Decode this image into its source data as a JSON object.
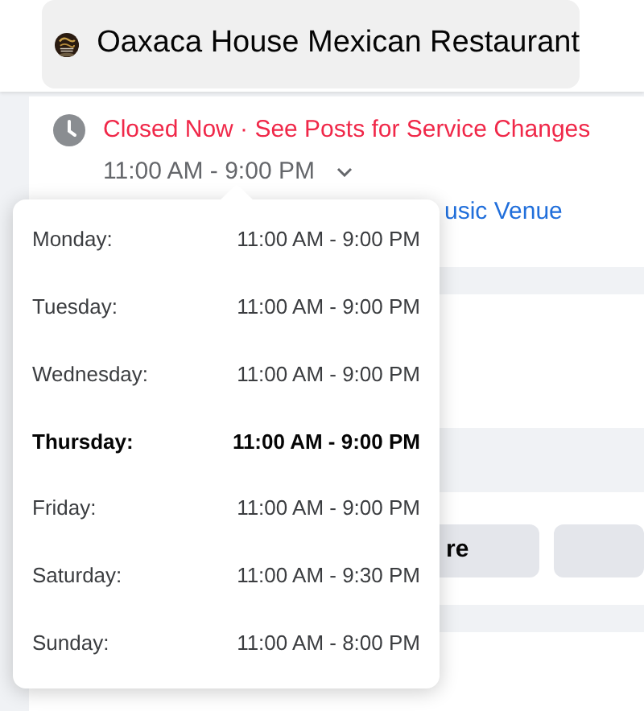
{
  "header": {
    "page_name": "Oaxaca House Mexican Restaurant"
  },
  "hours": {
    "status": "Closed Now · See Posts for Service Changes",
    "today_hours": "11:00 AM - 9:00 PM",
    "expanded": true
  },
  "category_link": "usic Venue",
  "action_button": "re",
  "schedule": [
    {
      "day": "Monday:",
      "hours": "11:00 AM - 9:00 PM",
      "today": false
    },
    {
      "day": "Tuesday:",
      "hours": "11:00 AM - 9:00 PM",
      "today": false
    },
    {
      "day": "Wednesday:",
      "hours": "11:00 AM - 9:00 PM",
      "today": false
    },
    {
      "day": "Thursday:",
      "hours": "11:00 AM - 9:00 PM",
      "today": true
    },
    {
      "day": "Friday:",
      "hours": "11:00 AM - 9:00 PM",
      "today": false
    },
    {
      "day": "Saturday:",
      "hours": "11:00 AM - 9:30 PM",
      "today": false
    },
    {
      "day": "Sunday:",
      "hours": "11:00 AM - 8:00 PM",
      "today": false
    }
  ]
}
